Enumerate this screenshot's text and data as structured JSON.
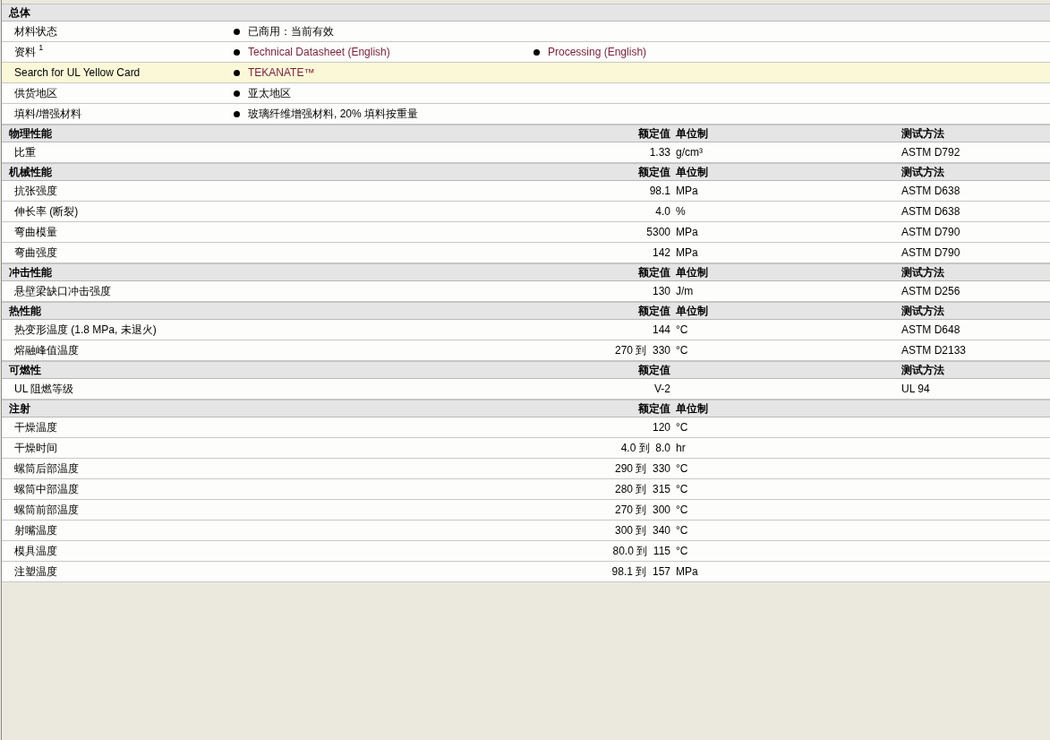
{
  "general": {
    "title": "总体",
    "rows": [
      {
        "label": "材料状态",
        "highlighted": false,
        "items": [
          {
            "text": "已商用：当前有效",
            "link": false
          }
        ]
      },
      {
        "label": "资料",
        "note": "1",
        "highlighted": false,
        "items": [
          {
            "text": "Technical Datasheet (English)",
            "link": true
          },
          {
            "text": "Processing (English)",
            "link": true
          }
        ]
      },
      {
        "label": "Search for UL Yellow Card",
        "highlighted": true,
        "items": [
          {
            "text": "TEKANATE™",
            "link": true
          }
        ]
      },
      {
        "label": "供货地区",
        "highlighted": false,
        "items": [
          {
            "text": "亚太地区",
            "link": false
          }
        ]
      },
      {
        "label": "填料/增强材料",
        "highlighted": false,
        "items": [
          {
            "text": "玻璃纤维增强材料, 20% 填料按重量",
            "link": false
          }
        ]
      }
    ]
  },
  "sections": [
    {
      "title": "物理性能",
      "headers": {
        "value": "额定值",
        "unit": "单位制",
        "method": "测试方法"
      },
      "rows": [
        {
          "name": "比重",
          "value": "1.33",
          "unit": "g/cm³",
          "method": "ASTM D792"
        }
      ]
    },
    {
      "title": "机械性能",
      "headers": {
        "value": "额定值",
        "unit": "单位制",
        "method": "测试方法"
      },
      "rows": [
        {
          "name": "抗张强度",
          "value": "98.1",
          "unit": "MPa",
          "method": "ASTM D638"
        },
        {
          "name": "伸长率 (断裂)",
          "value": "4.0",
          "unit": "%",
          "method": "ASTM D638"
        },
        {
          "name": "弯曲模量",
          "value": "5300",
          "unit": "MPa",
          "method": "ASTM D790"
        },
        {
          "name": "弯曲强度",
          "value": "142",
          "unit": "MPa",
          "method": "ASTM D790"
        }
      ]
    },
    {
      "title": "冲击性能",
      "headers": {
        "value": "额定值",
        "unit": "单位制",
        "method": "测试方法"
      },
      "rows": [
        {
          "name": "悬壁梁缺口冲击强度",
          "value": "130",
          "unit": "J/m",
          "method": "ASTM D256"
        }
      ]
    },
    {
      "title": "热性能",
      "headers": {
        "value": "额定值",
        "unit": "单位制",
        "method": "测试方法"
      },
      "rows": [
        {
          "name": "热变形温度 (1.8 MPa, 未退火)",
          "value": "144",
          "unit": "°C",
          "method": "ASTM D648"
        },
        {
          "name": "熔融峰值温度",
          "value": "270 到  330",
          "unit": "°C",
          "method": "ASTM D2133"
        }
      ]
    },
    {
      "title": "可燃性",
      "headers": {
        "value": "额定值",
        "method": "测试方法"
      },
      "rows": [
        {
          "name": "UL 阻燃等级",
          "value": "V-2",
          "method": "UL 94"
        }
      ]
    },
    {
      "title": "注射",
      "headers": {
        "value": "额定值",
        "unit": "单位制"
      },
      "rows": [
        {
          "name": "干燥温度",
          "value": "120",
          "unit": "°C"
        },
        {
          "name": "干燥时间",
          "value": "4.0 到  8.0",
          "unit": "hr"
        },
        {
          "name": "螺筒后部温度",
          "value": "290 到  330",
          "unit": "°C"
        },
        {
          "name": "螺筒中部温度",
          "value": "280 到  315",
          "unit": "°C"
        },
        {
          "name": "螺筒前部温度",
          "value": "270 到  300",
          "unit": "°C"
        },
        {
          "name": "射嘴温度",
          "value": "300 到  340",
          "unit": "°C"
        },
        {
          "name": "模具温度",
          "value": "80.0 到  115",
          "unit": "°C"
        },
        {
          "name": "注塑温度",
          "value": "98.1 到  157",
          "unit": "MPa"
        }
      ]
    }
  ]
}
